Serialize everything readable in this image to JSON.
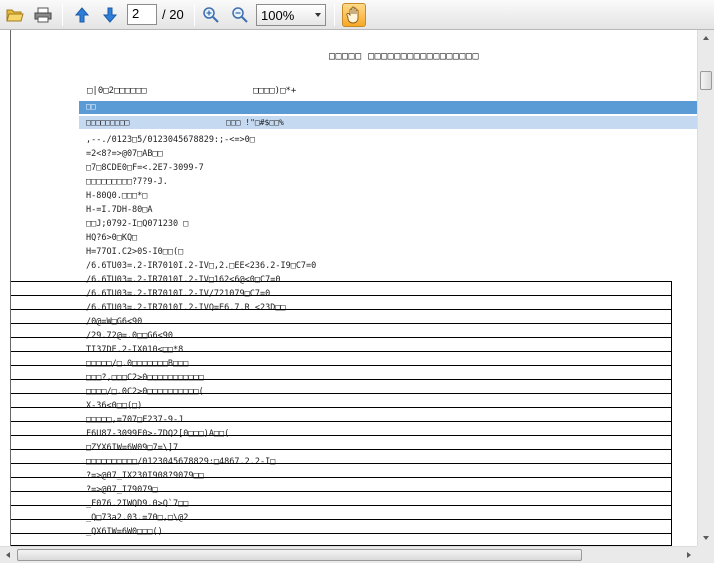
{
  "toolbar": {
    "open_icon": "folder-open-icon",
    "print_icon": "printer-icon",
    "prev_icon": "arrow-up-icon",
    "next_icon": "arrow-down-icon",
    "page_number": "2",
    "page_total": "/ 20",
    "zoom_in_icon": "zoom-in-icon",
    "zoom_out_icon": "zoom-out-icon",
    "zoom_value": "100%",
    "hand_tool_icon": "hand-icon",
    "hand_tool_color": "#f7a928",
    "nav_arrow_color": "#2f7fd8"
  },
  "document": {
    "title": "□□□□□  □□□□□□□□□□□□□□□□□",
    "header_left": "□|0□2□□□□□□",
    "header_right": "□□□□)□*+",
    "band_dark_text": "□□",
    "band_dark_color": "#5b9bd5",
    "band_light_left": "□□□□□□□□□",
    "band_light_right": "□□□ !\"□#$□□%",
    "band_light_color": "#c5d9f1",
    "lines": [
      ",--./0123□5/0123045678829:;-<=>0□",
      "=2<8?=>@07□AB□□",
      "□7□8CDE0□F=<.2E7-3099-7",
      "□□□□□□□□□?7?9-J.",
      "H-80Q0.□□□*□",
      "H-=I.7DH-80□A",
      "□□J;0792-I□Q071230        □",
      "HQ?6>0□KQ□",
      "H=77OI.C2>0S-I0□□(□",
      "/6.6TU03=.2-IR7010I.2-IV□,2.□EE<236.2-I9□C7=0",
      "/6.6TU03=.2-IR7010I.2-IV□162<6@<0□C7=0",
      "/6.6TU03=.2-IR7010I.2-IV/721079□C7=0",
      "/6.6TU03=.2-IR7010I.2-IVQ=E6.7.R <23D□□",
      "/0@=W□G6<90",
      "/29.72@=.0□□G6<90",
      "TI37DE.2-IX010<□□*8",
      "□□□□□/□.0□□□□□□□B□□□",
      "□□□?,□□□C2>0□□□□□□□□□□□",
      "□□□□/□.0C2>0□□□□□□□□□□(",
      "X-36<0□□(□)",
      "□□□□□,=707□F237-9-J",
      "F6U87-3099F0>-7DQ2[0□□□)A□□(",
      "□ZYX6IW=6W09□7=\\]7",
      "□□□□□□□□□□/0123045678829:□4867.2.2-I□",
      "?=>@07_IX230I908?9079□□",
      "?=>@07_I79079□",
      "_F076.2IWQD9.0>Q`7□□",
      "_Q□73a2.03.=70□,□\\@2",
      "_QX6IW=6W0□□□()"
    ]
  }
}
